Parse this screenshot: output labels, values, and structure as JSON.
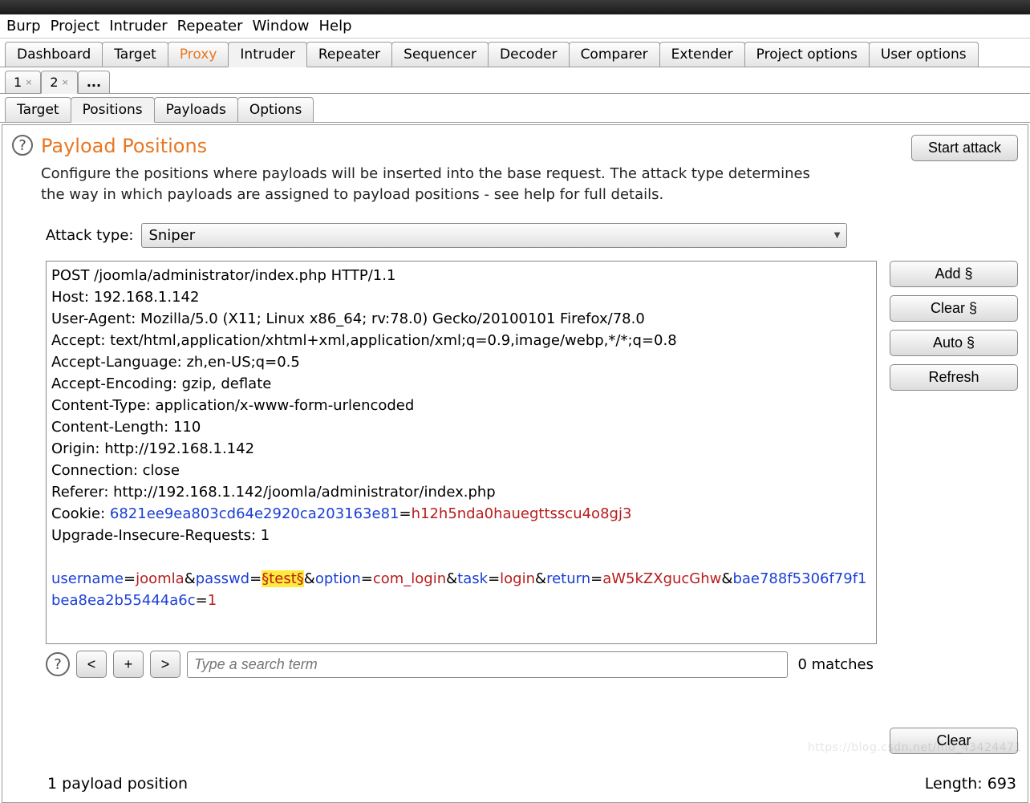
{
  "menu": {
    "burp": "Burp",
    "project": "Project",
    "intruder": "Intruder",
    "repeater": "Repeater",
    "window": "Window",
    "help": "Help"
  },
  "main_tabs": {
    "dashboard": "Dashboard",
    "target": "Target",
    "proxy": "Proxy",
    "intruder": "Intruder",
    "repeater": "Repeater",
    "sequencer": "Sequencer",
    "decoder": "Decoder",
    "comparer": "Comparer",
    "extender": "Extender",
    "project_options": "Project options",
    "user_options": "User options"
  },
  "session_tabs": {
    "t1": "1",
    "t2": "2",
    "dots": "..."
  },
  "inner_tabs": {
    "target": "Target",
    "positions": "Positions",
    "payloads": "Payloads",
    "options": "Options"
  },
  "panel": {
    "title": "Payload Positions",
    "desc": "Configure the positions where payloads will be inserted into the base request. The attack type determines the way in which payloads are assigned to payload positions - see help for full details.",
    "attack_type_label": "Attack type:",
    "attack_type_value": "Sniper"
  },
  "buttons": {
    "start": "Start attack",
    "add": "Add §",
    "clear_m": "Clear §",
    "auto": "Auto §",
    "refresh": "Refresh",
    "clear": "Clear"
  },
  "request": {
    "line1": "POST /joomla/administrator/index.php HTTP/1.1",
    "host": "Host: 192.168.1.142",
    "ua": "User-Agent: Mozilla/5.0 (X11; Linux x86_64; rv:78.0) Gecko/20100101 Firefox/78.0",
    "accept": "Accept: text/html,application/xhtml+xml,application/xml;q=0.9,image/webp,*/*;q=0.8",
    "accept_lang": "Accept-Language: zh,en-US;q=0.5",
    "accept_enc": "Accept-Encoding: gzip, deflate",
    "ctype": "Content-Type: application/x-www-form-urlencoded",
    "clen": "Content-Length: 110",
    "origin": "Origin: http://192.168.1.142",
    "conn": "Connection: close",
    "referer": "Referer: http://192.168.1.142/joomla/administrator/index.php",
    "cookie_label": "Cookie: ",
    "cookie_name": "6821ee9ea803cd64e2920ca203163e81",
    "cookie_val": "h12h5nda0hauegttsscu4o8gj3",
    "upgrade": "Upgrade-Insecure-Requests: 1",
    "body": {
      "p_username": "username",
      "v_username": "joomla",
      "p_passwd": "passwd",
      "v_passwd": "§test§",
      "p_option": "option",
      "v_option": "com_login",
      "p_task": "task",
      "v_task": "login",
      "p_return": "return",
      "v_return": "aW5kZXgucGhw",
      "p_token": "bae788f5306f79f1bea8ea2b55444a6c",
      "v_token": "1",
      "amp": "&",
      "eq": "="
    }
  },
  "search": {
    "help": "?",
    "lt": "<",
    "plus": "+",
    "gt": ">",
    "placeholder": "Type a search term",
    "matches": "0 matches"
  },
  "status": {
    "left": "1 payload position",
    "right": "Length: 693"
  },
  "watermark": "https://blog.csdn.net/m0_43424471"
}
